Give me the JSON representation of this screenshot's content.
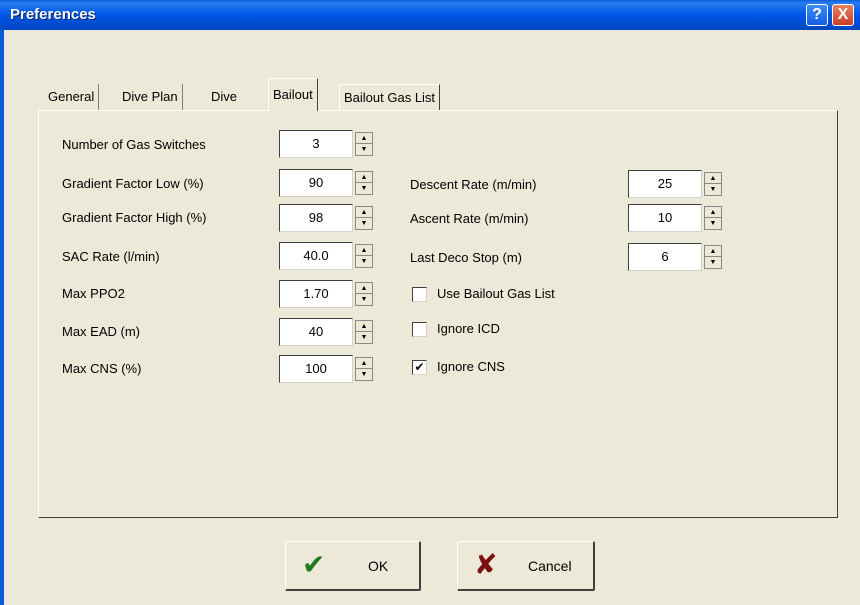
{
  "window": {
    "title": "Preferences",
    "help_icon": "?",
    "close_icon": "X"
  },
  "tabs": [
    {
      "label": "General",
      "active": false
    },
    {
      "label": "Dive Plan",
      "active": false
    },
    {
      "label": "Dive",
      "active": false
    },
    {
      "label": "Bailout",
      "active": true
    },
    {
      "label": "Bailout Gas List",
      "active": false
    }
  ],
  "left_fields": [
    {
      "label": "Number of Gas Switches",
      "value": "3"
    },
    {
      "label": "Gradient Factor Low (%)",
      "value": "90"
    },
    {
      "label": "Gradient Factor High (%)",
      "value": "98"
    },
    {
      "label": "SAC Rate (l/min)",
      "value": "40.0"
    },
    {
      "label": "Max PPO2",
      "value": "1.70"
    },
    {
      "label": "Max EAD (m)",
      "value": "40"
    },
    {
      "label": "Max CNS (%)",
      "value": "100"
    }
  ],
  "right_fields": [
    {
      "label": "Descent Rate (m/min)",
      "value": "25"
    },
    {
      "label": "Ascent Rate (m/min)",
      "value": "10"
    },
    {
      "label": "Last Deco Stop (m)",
      "value": "6"
    }
  ],
  "checkboxes": [
    {
      "label": "Use Bailout Gas List",
      "checked": false,
      "mark": ""
    },
    {
      "label": "Ignore ICD",
      "checked": false,
      "mark": ""
    },
    {
      "label": "Ignore CNS",
      "checked": true,
      "mark": "✔"
    }
  ],
  "buttons": {
    "ok_label": "OK",
    "ok_icon": "✔",
    "cancel_label": "Cancel",
    "cancel_icon": "✘"
  },
  "colors": {
    "titlebar": "#0058e6",
    "dialog_bg": "#ece9d8",
    "ok_icon": "#1d7a1d",
    "cancel_icon": "#7a1010"
  },
  "icons": {
    "spin_up": "▲",
    "spin_down": "▼"
  }
}
